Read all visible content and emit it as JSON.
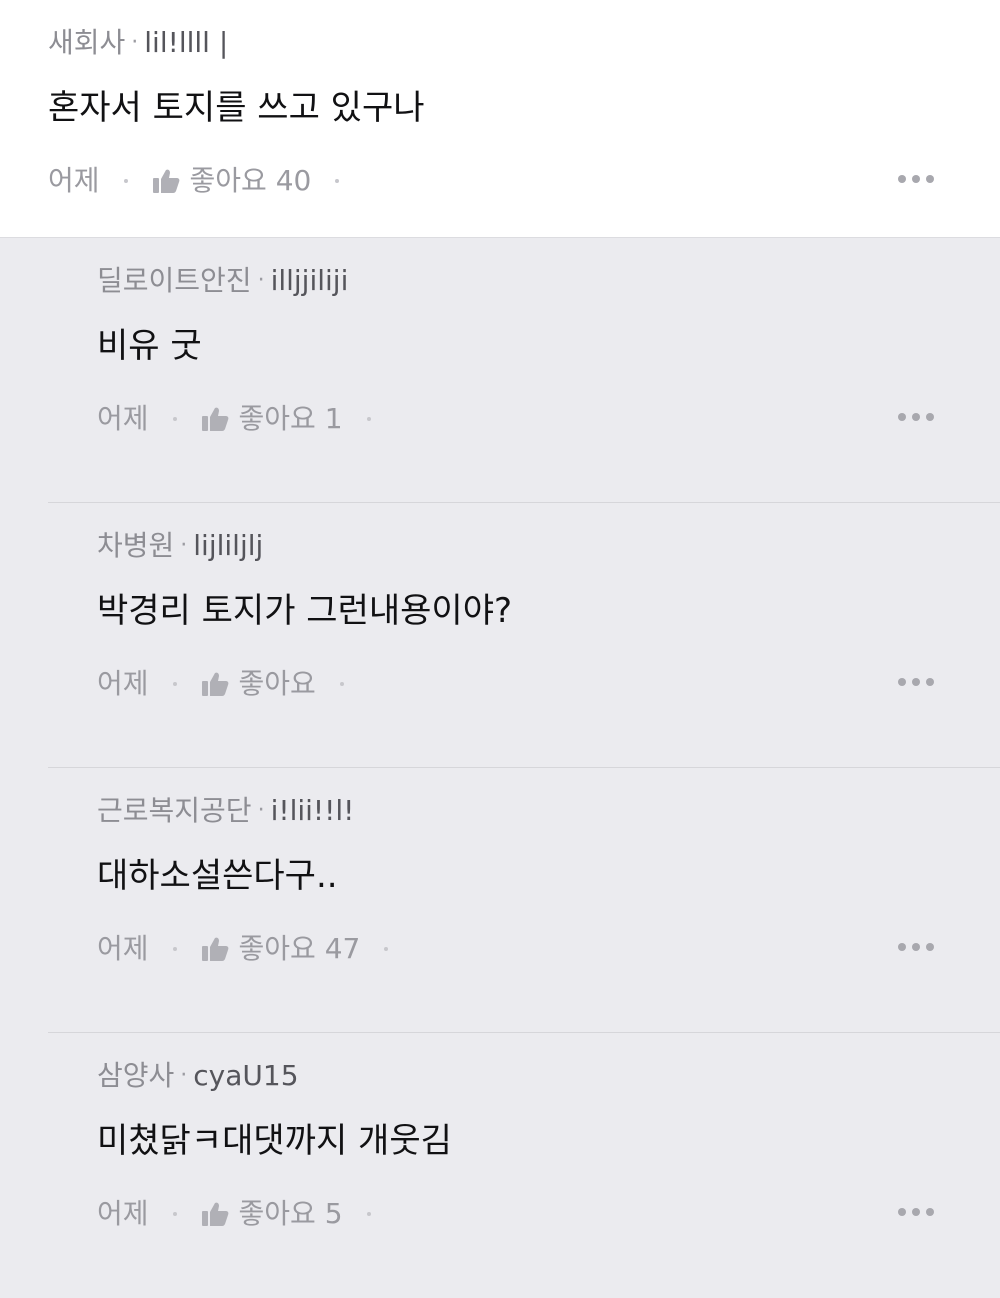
{
  "main_comment": {
    "author": "새회사",
    "user_id": "lil!llll |",
    "text": "혼자서 토지를 쓰고 있구나",
    "time": "어제",
    "like_label": "좋아요",
    "like_count": "40"
  },
  "replies": [
    {
      "author": "딜로이트안진",
      "user_id": "illjjiliji",
      "text": "비유 굿",
      "time": "어제",
      "like_label": "좋아요",
      "like_count": "1"
    },
    {
      "author": "차병원",
      "user_id": "lijliljlj",
      "text": "박경리 토지가 그런내용이야?",
      "time": "어제",
      "like_label": "좋아요",
      "like_count": ""
    },
    {
      "author": "근로복지공단",
      "user_id": "i!lii!!l!",
      "text": "대하소설쓴다구..",
      "time": "어제",
      "like_label": "좋아요",
      "like_count": "47"
    },
    {
      "author": "삼양사",
      "user_id": "cyaU15",
      "text": "미쳤닭ㅋ대댓까지 개웃김",
      "time": "어제",
      "like_label": "좋아요",
      "like_count": "5"
    }
  ],
  "icons": {
    "like": "thumbs-up-icon",
    "more": "more-dots-icon"
  },
  "colors": {
    "main_background": "#ffffff",
    "reply_background": "#ebebef",
    "meta_text": "#8d8d93",
    "body_text": "#111113"
  }
}
